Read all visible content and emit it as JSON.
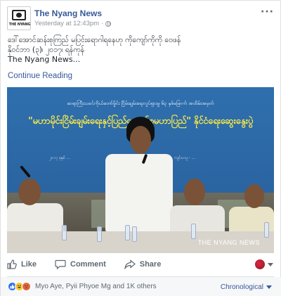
{
  "post": {
    "page_name": "The Nyang News",
    "logo_text": "THE NYANG",
    "timestamp": "Yesterday at 12:43pm",
    "separator": "·",
    "more_glyph": "···",
    "text_lines": [
      "ဒေါ်အောင်ဆန်းစုကြည် မပြင်းရောဂါရနေဟု ကိုကျော်ကိုကို ဝေဖန်",
      "နိုဝင်ဘာ (၃)၊ ၂၀၁၇၊ ရန်ကုန်",
      "The Nyang News..."
    ],
    "continue_label": "Continue Reading"
  },
  "photo": {
    "banner_subtitle": "ဆရာကြီးသခင်ကိုယ်တော်မှိုင်း ငြိမ်းချမ်းရေးလှုပ်ရှားမှု ၆၃ နှစ်မြောက် အထိမ်းအမှတ်",
    "banner_title": "\"မဟာမိုင်းငြိမ်းချမ်းရေးနှင့်ပြည်ထောင်စုမဟာပြည်\" နိုင်ငံရေးဆွေးနွေးပွဲ",
    "banner_date": "၂၀၁၇ ခုနှစ် ...",
    "banner_org": "ကျင်းပသူ - ...",
    "watermark": "THE NYANG NEWS"
  },
  "actions": {
    "like_label": "Like",
    "comment_label": "Comment",
    "share_label": "Share"
  },
  "footer": {
    "reactors": "Myo Aye, Pyii Phyoe Mg and 1K others",
    "order_label": "Chronological"
  },
  "colors": {
    "link": "#365899",
    "muted": "#90949c",
    "banner_blue": "#2f6fae",
    "banner_title": "#f7e84b",
    "like_blue": "#2e72ea"
  },
  "icons": [
    "globe-icon",
    "more-icon",
    "like-icon",
    "comment-icon",
    "share-icon",
    "chevron-down-icon"
  ]
}
